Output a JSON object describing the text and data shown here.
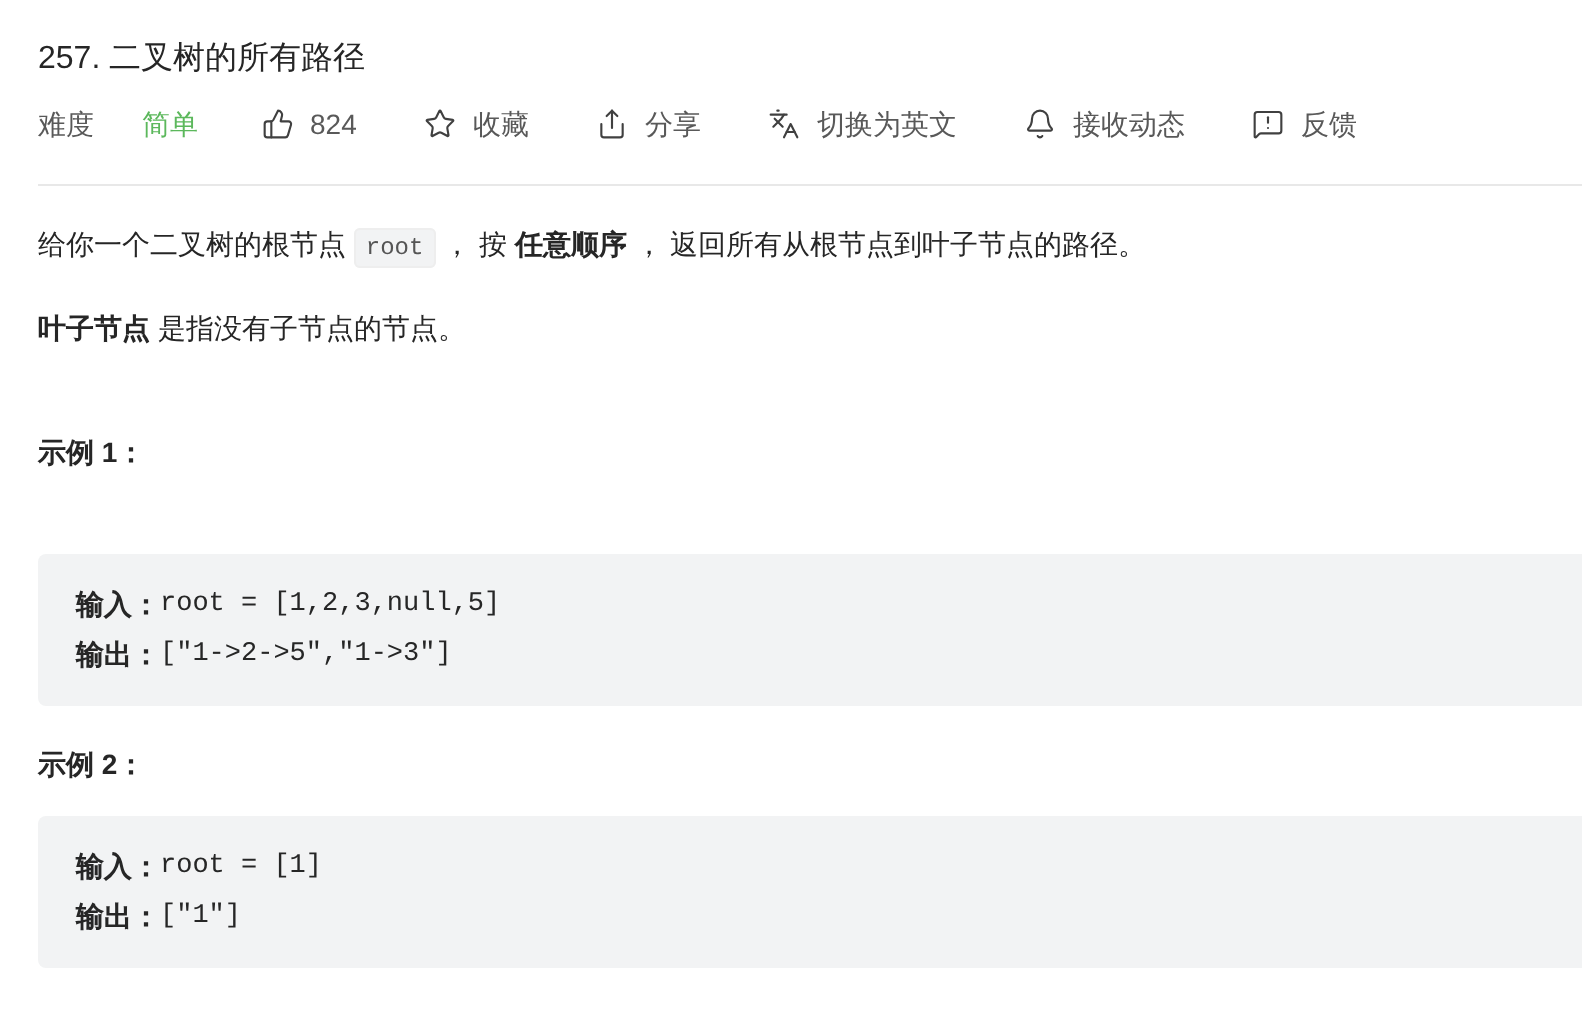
{
  "title": "257. 二叉树的所有路径",
  "toolbar": [
    {
      "kind": "label",
      "text": "难度"
    },
    {
      "kind": "difficulty",
      "text": "简单",
      "color": "#5cb85c"
    },
    {
      "kind": "like",
      "text": "824"
    },
    {
      "kind": "favorite",
      "text": "收藏"
    },
    {
      "kind": "share",
      "text": "分享"
    },
    {
      "kind": "translate",
      "text": "切换为英文"
    },
    {
      "kind": "notify",
      "text": "接收动态"
    },
    {
      "kind": "feedback",
      "text": "反馈"
    }
  ],
  "description": [
    [
      {
        "kind": "text",
        "text": "给你一个二叉树的根节点 "
      },
      {
        "kind": "code",
        "text": "root"
      },
      {
        "kind": "text",
        "text": " ， 按 **任意顺序** ， 返回所有从根节点到叶子节点的路径。"
      }
    ],
    [
      {
        "kind": "text",
        "text": "**叶子节点** 是指没有子节点的节点。"
      }
    ]
  ],
  "examples": [
    {
      "title": "示例 1：",
      "lines": [
        {
          "label": "输入：",
          "value": "root = [1,2,3,null,5]"
        },
        {
          "label": "输出：",
          "value": "[\"1->2->5\",\"1->3\"]"
        }
      ]
    },
    {
      "title": "示例 2：",
      "lines": [
        {
          "label": "输入：",
          "value": "root = [1]"
        },
        {
          "label": "输出：",
          "value": "[\"1\"]"
        }
      ]
    }
  ]
}
